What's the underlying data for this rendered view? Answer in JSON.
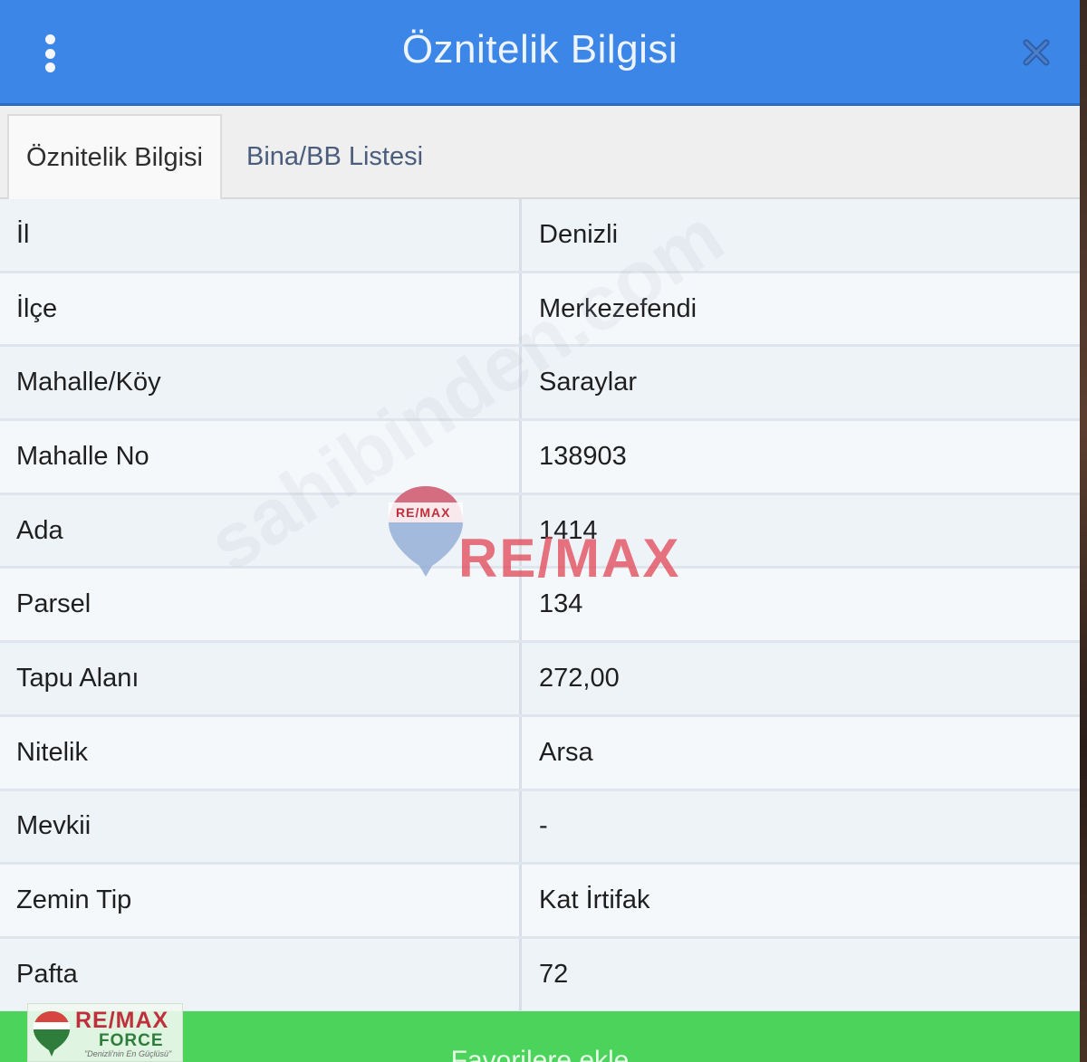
{
  "header": {
    "title": "Öznitelik Bilgisi",
    "menu_icon": "more-vertical-icon",
    "close_icon": "close-icon",
    "color": "#3b86e6"
  },
  "tabs": [
    {
      "label": "Öznitelik Bilgisi",
      "active": true
    },
    {
      "label": "Bina/BB Listesi",
      "active": false
    }
  ],
  "attributes": [
    {
      "label": "İl",
      "value": "Denizli"
    },
    {
      "label": "İlçe",
      "value": "Merkezefendi"
    },
    {
      "label": "Mahalle/Köy",
      "value": "Saraylar"
    },
    {
      "label": "Mahalle No",
      "value": "138903"
    },
    {
      "label": "Ada",
      "value": "1414"
    },
    {
      "label": "Parsel",
      "value": "134"
    },
    {
      "label": "Tapu Alanı",
      "value": "272,00"
    },
    {
      "label": "Nitelik",
      "value": "Arsa"
    },
    {
      "label": "Mevkii",
      "value": "-"
    },
    {
      "label": "Zemin Tip",
      "value": "Kat İrtifak"
    },
    {
      "label": "Pafta",
      "value": "72"
    }
  ],
  "footer": {
    "button_label": "Favorilere ekle",
    "color": "#4cd35c"
  },
  "watermarks": {
    "balloon_text": "RE/MAX",
    "brand": "RE/MAX",
    "site": "sahibinden.com",
    "corner_brand": "RE/MAX",
    "corner_sub": "FORCE",
    "corner_tagline": "\"Denizli'nin En Güçlüsü\""
  }
}
